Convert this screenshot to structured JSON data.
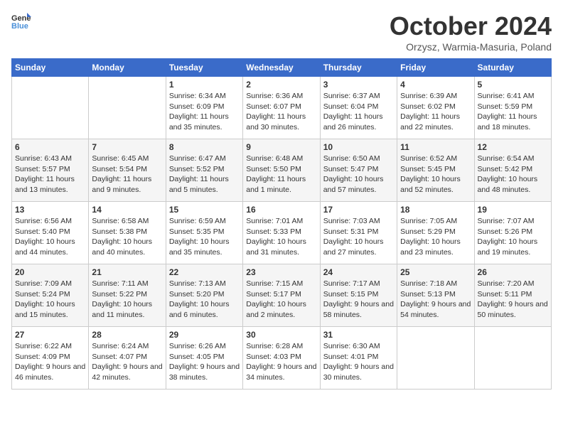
{
  "header": {
    "logo_general": "General",
    "logo_blue": "Blue",
    "month_title": "October 2024",
    "location": "Orzysz, Warmia-Masuria, Poland"
  },
  "calendar": {
    "days_of_week": [
      "Sunday",
      "Monday",
      "Tuesday",
      "Wednesday",
      "Thursday",
      "Friday",
      "Saturday"
    ],
    "weeks": [
      [
        {
          "day": "",
          "sunrise": "",
          "sunset": "",
          "daylight": ""
        },
        {
          "day": "",
          "sunrise": "",
          "sunset": "",
          "daylight": ""
        },
        {
          "day": "1",
          "sunrise": "Sunrise: 6:34 AM",
          "sunset": "Sunset: 6:09 PM",
          "daylight": "Daylight: 11 hours and 35 minutes."
        },
        {
          "day": "2",
          "sunrise": "Sunrise: 6:36 AM",
          "sunset": "Sunset: 6:07 PM",
          "daylight": "Daylight: 11 hours and 30 minutes."
        },
        {
          "day": "3",
          "sunrise": "Sunrise: 6:37 AM",
          "sunset": "Sunset: 6:04 PM",
          "daylight": "Daylight: 11 hours and 26 minutes."
        },
        {
          "day": "4",
          "sunrise": "Sunrise: 6:39 AM",
          "sunset": "Sunset: 6:02 PM",
          "daylight": "Daylight: 11 hours and 22 minutes."
        },
        {
          "day": "5",
          "sunrise": "Sunrise: 6:41 AM",
          "sunset": "Sunset: 5:59 PM",
          "daylight": "Daylight: 11 hours and 18 minutes."
        }
      ],
      [
        {
          "day": "6",
          "sunrise": "Sunrise: 6:43 AM",
          "sunset": "Sunset: 5:57 PM",
          "daylight": "Daylight: 11 hours and 13 minutes."
        },
        {
          "day": "7",
          "sunrise": "Sunrise: 6:45 AM",
          "sunset": "Sunset: 5:54 PM",
          "daylight": "Daylight: 11 hours and 9 minutes."
        },
        {
          "day": "8",
          "sunrise": "Sunrise: 6:47 AM",
          "sunset": "Sunset: 5:52 PM",
          "daylight": "Daylight: 11 hours and 5 minutes."
        },
        {
          "day": "9",
          "sunrise": "Sunrise: 6:48 AM",
          "sunset": "Sunset: 5:50 PM",
          "daylight": "Daylight: 11 hours and 1 minute."
        },
        {
          "day": "10",
          "sunrise": "Sunrise: 6:50 AM",
          "sunset": "Sunset: 5:47 PM",
          "daylight": "Daylight: 10 hours and 57 minutes."
        },
        {
          "day": "11",
          "sunrise": "Sunrise: 6:52 AM",
          "sunset": "Sunset: 5:45 PM",
          "daylight": "Daylight: 10 hours and 52 minutes."
        },
        {
          "day": "12",
          "sunrise": "Sunrise: 6:54 AM",
          "sunset": "Sunset: 5:42 PM",
          "daylight": "Daylight: 10 hours and 48 minutes."
        }
      ],
      [
        {
          "day": "13",
          "sunrise": "Sunrise: 6:56 AM",
          "sunset": "Sunset: 5:40 PM",
          "daylight": "Daylight: 10 hours and 44 minutes."
        },
        {
          "day": "14",
          "sunrise": "Sunrise: 6:58 AM",
          "sunset": "Sunset: 5:38 PM",
          "daylight": "Daylight: 10 hours and 40 minutes."
        },
        {
          "day": "15",
          "sunrise": "Sunrise: 6:59 AM",
          "sunset": "Sunset: 5:35 PM",
          "daylight": "Daylight: 10 hours and 35 minutes."
        },
        {
          "day": "16",
          "sunrise": "Sunrise: 7:01 AM",
          "sunset": "Sunset: 5:33 PM",
          "daylight": "Daylight: 10 hours and 31 minutes."
        },
        {
          "day": "17",
          "sunrise": "Sunrise: 7:03 AM",
          "sunset": "Sunset: 5:31 PM",
          "daylight": "Daylight: 10 hours and 27 minutes."
        },
        {
          "day": "18",
          "sunrise": "Sunrise: 7:05 AM",
          "sunset": "Sunset: 5:29 PM",
          "daylight": "Daylight: 10 hours and 23 minutes."
        },
        {
          "day": "19",
          "sunrise": "Sunrise: 7:07 AM",
          "sunset": "Sunset: 5:26 PM",
          "daylight": "Daylight: 10 hours and 19 minutes."
        }
      ],
      [
        {
          "day": "20",
          "sunrise": "Sunrise: 7:09 AM",
          "sunset": "Sunset: 5:24 PM",
          "daylight": "Daylight: 10 hours and 15 minutes."
        },
        {
          "day": "21",
          "sunrise": "Sunrise: 7:11 AM",
          "sunset": "Sunset: 5:22 PM",
          "daylight": "Daylight: 10 hours and 11 minutes."
        },
        {
          "day": "22",
          "sunrise": "Sunrise: 7:13 AM",
          "sunset": "Sunset: 5:20 PM",
          "daylight": "Daylight: 10 hours and 6 minutes."
        },
        {
          "day": "23",
          "sunrise": "Sunrise: 7:15 AM",
          "sunset": "Sunset: 5:17 PM",
          "daylight": "Daylight: 10 hours and 2 minutes."
        },
        {
          "day": "24",
          "sunrise": "Sunrise: 7:17 AM",
          "sunset": "Sunset: 5:15 PM",
          "daylight": "Daylight: 9 hours and 58 minutes."
        },
        {
          "day": "25",
          "sunrise": "Sunrise: 7:18 AM",
          "sunset": "Sunset: 5:13 PM",
          "daylight": "Daylight: 9 hours and 54 minutes."
        },
        {
          "day": "26",
          "sunrise": "Sunrise: 7:20 AM",
          "sunset": "Sunset: 5:11 PM",
          "daylight": "Daylight: 9 hours and 50 minutes."
        }
      ],
      [
        {
          "day": "27",
          "sunrise": "Sunrise: 6:22 AM",
          "sunset": "Sunset: 4:09 PM",
          "daylight": "Daylight: 9 hours and 46 minutes."
        },
        {
          "day": "28",
          "sunrise": "Sunrise: 6:24 AM",
          "sunset": "Sunset: 4:07 PM",
          "daylight": "Daylight: 9 hours and 42 minutes."
        },
        {
          "day": "29",
          "sunrise": "Sunrise: 6:26 AM",
          "sunset": "Sunset: 4:05 PM",
          "daylight": "Daylight: 9 hours and 38 minutes."
        },
        {
          "day": "30",
          "sunrise": "Sunrise: 6:28 AM",
          "sunset": "Sunset: 4:03 PM",
          "daylight": "Daylight: 9 hours and 34 minutes."
        },
        {
          "day": "31",
          "sunrise": "Sunrise: 6:30 AM",
          "sunset": "Sunset: 4:01 PM",
          "daylight": "Daylight: 9 hours and 30 minutes."
        },
        {
          "day": "",
          "sunrise": "",
          "sunset": "",
          "daylight": ""
        },
        {
          "day": "",
          "sunrise": "",
          "sunset": "",
          "daylight": ""
        }
      ]
    ]
  }
}
